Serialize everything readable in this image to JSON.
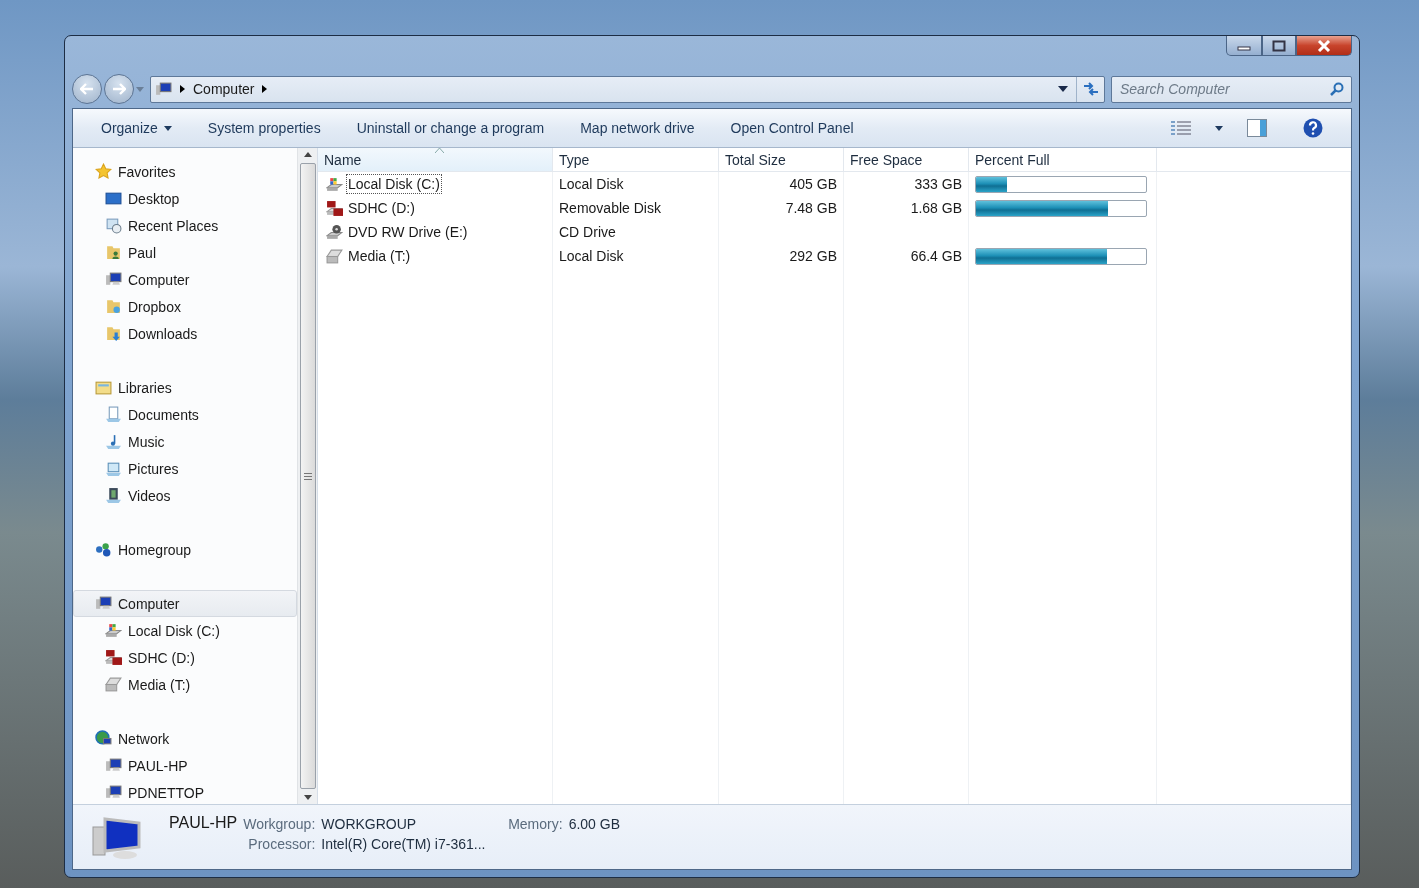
{
  "address_bar": {
    "path": [
      {
        "label": "Computer"
      }
    ]
  },
  "search": {
    "placeholder": "Search Computer"
  },
  "toolbar": [
    {
      "label": "Organize",
      "dropdown": true
    },
    {
      "label": "System properties",
      "dropdown": false
    },
    {
      "label": "Uninstall or change a program",
      "dropdown": false
    },
    {
      "label": "Map network drive",
      "dropdown": false
    },
    {
      "label": "Open Control Panel",
      "dropdown": false
    }
  ],
  "sidebar": {
    "sections": [
      {
        "label": "Favorites",
        "kind": "star",
        "selected": false,
        "children": [
          {
            "label": "Desktop",
            "kind": "desktop",
            "selected": false
          },
          {
            "label": "Recent Places",
            "kind": "recent",
            "selected": false
          },
          {
            "label": "Paul",
            "kind": "user",
            "selected": false
          },
          {
            "label": "Computer",
            "kind": "computer",
            "selected": false
          },
          {
            "label": "Dropbox",
            "kind": "folder",
            "selected": false
          },
          {
            "label": "Downloads",
            "kind": "download",
            "selected": false
          }
        ]
      },
      {
        "label": "Libraries",
        "kind": "library",
        "selected": false,
        "children": [
          {
            "label": "Documents",
            "kind": "document",
            "selected": false
          },
          {
            "label": "Music",
            "kind": "music",
            "selected": false
          },
          {
            "label": "Pictures",
            "kind": "picture",
            "selected": false
          },
          {
            "label": "Videos",
            "kind": "video",
            "selected": false
          }
        ]
      },
      {
        "label": "Homegroup",
        "kind": "homegroup",
        "selected": false
      },
      {
        "label": "Computer",
        "kind": "computer",
        "selected": true,
        "children": [
          {
            "label": "Local Disk (C:)",
            "kind": "disk",
            "selected": false
          },
          {
            "label": "SDHC (D:)",
            "kind": "sd",
            "selected": false
          },
          {
            "label": "Media (T:)",
            "kind": "drive",
            "selected": false
          }
        ]
      },
      {
        "label": "Network",
        "kind": "network",
        "selected": false,
        "children": [
          {
            "label": "PAUL-HP",
            "kind": "computer",
            "selected": false
          },
          {
            "label": "PDNETTOP",
            "kind": "computer",
            "selected": false
          }
        ]
      }
    ]
  },
  "table": {
    "columns": [
      {
        "label": "Name",
        "sorted": true
      },
      {
        "label": "Type",
        "sorted": false
      },
      {
        "label": "Total Size",
        "sorted": false
      },
      {
        "label": "Free Space",
        "sorted": false
      },
      {
        "label": "Percent Full",
        "sorted": false
      }
    ],
    "rows": [
      {
        "name": "Local Disk (C:)",
        "kind": "disk",
        "focused": true,
        "type": "Local Disk",
        "total": "405 GB",
        "free": "333 GB",
        "level": 0.18
      },
      {
        "name": "SDHC (D:)",
        "kind": "sd",
        "focused": false,
        "type": "Removable Disk",
        "total": "7.48 GB",
        "free": "1.68 GB",
        "level": 0.775
      },
      {
        "name": "DVD RW Drive (E:)",
        "kind": "dvd",
        "focused": false,
        "type": "CD Drive"
      },
      {
        "name": "Media (T:)",
        "kind": "drive",
        "focused": false,
        "type": "Local Disk",
        "total": "292 GB",
        "free": "66.4 GB",
        "level": 0.773
      }
    ]
  },
  "details": {
    "name": "PAUL-HP",
    "fields": [
      {
        "label": "Workgroup:",
        "value": "WORKGROUP"
      },
      {
        "label": "Memory:",
        "value": "6.00 GB"
      },
      {
        "label": "Processor:",
        "value": "Intel(R) Core(TM) i7-361..."
      }
    ]
  }
}
